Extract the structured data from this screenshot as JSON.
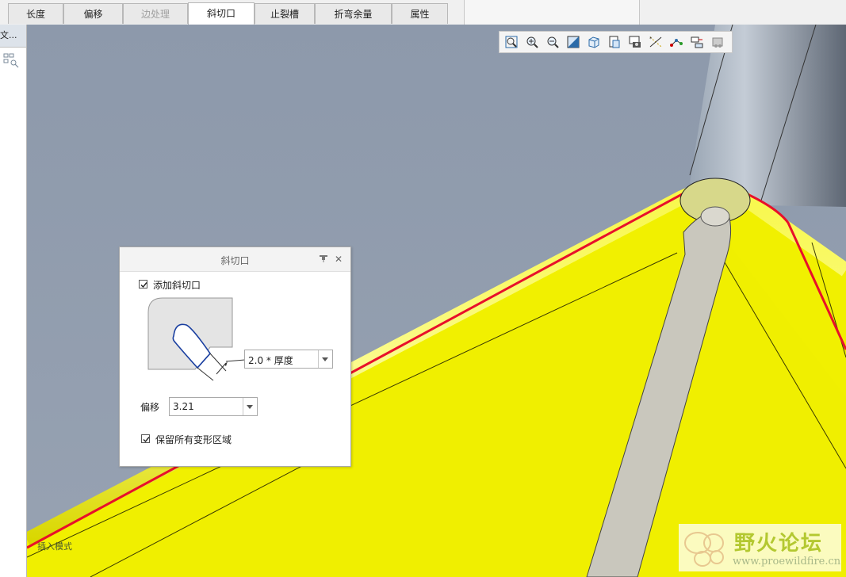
{
  "tabs": [
    {
      "label": "长度",
      "state": "normal"
    },
    {
      "label": "偏移",
      "state": "normal"
    },
    {
      "label": "边处理",
      "state": "disabled"
    },
    {
      "label": "斜切口",
      "state": "active"
    },
    {
      "label": "止裂槽",
      "state": "normal"
    },
    {
      "label": "折弯余量",
      "state": "normal"
    },
    {
      "label": "属性",
      "state": "normal"
    }
  ],
  "left_panel": {
    "header_text": "文..."
  },
  "graphics_toolbar": {
    "icons": [
      "refit-icon",
      "zoom-in-icon",
      "zoom-out-icon",
      "repaint-icon",
      "display-style-icon",
      "saved-views-icon",
      "view-manager-icon",
      "datum-display-icon",
      "spin-center-icon",
      "annotation-display-icon",
      "simulation-display-icon"
    ]
  },
  "dialog": {
    "title": "斜切口",
    "add_miter_label": "添加斜切口",
    "add_miter_checked": true,
    "width_value": "2.0 * 厚度",
    "offset_label": "偏移",
    "offset_value": "3.21",
    "keep_deform_label": "保留所有变形区域",
    "keep_deform_checked": true
  },
  "viewport": {
    "hint": "插入模式"
  },
  "watermark": {
    "title": "野火论坛",
    "url": "www.proewildfire.cn"
  },
  "colors": {
    "background_gray": "#8e9aab",
    "part_yellow": "#f1f000",
    "edge_red": "#e8102a",
    "cut_gray": "#c9c7bd",
    "preview_blue": "#1a3fa0"
  }
}
